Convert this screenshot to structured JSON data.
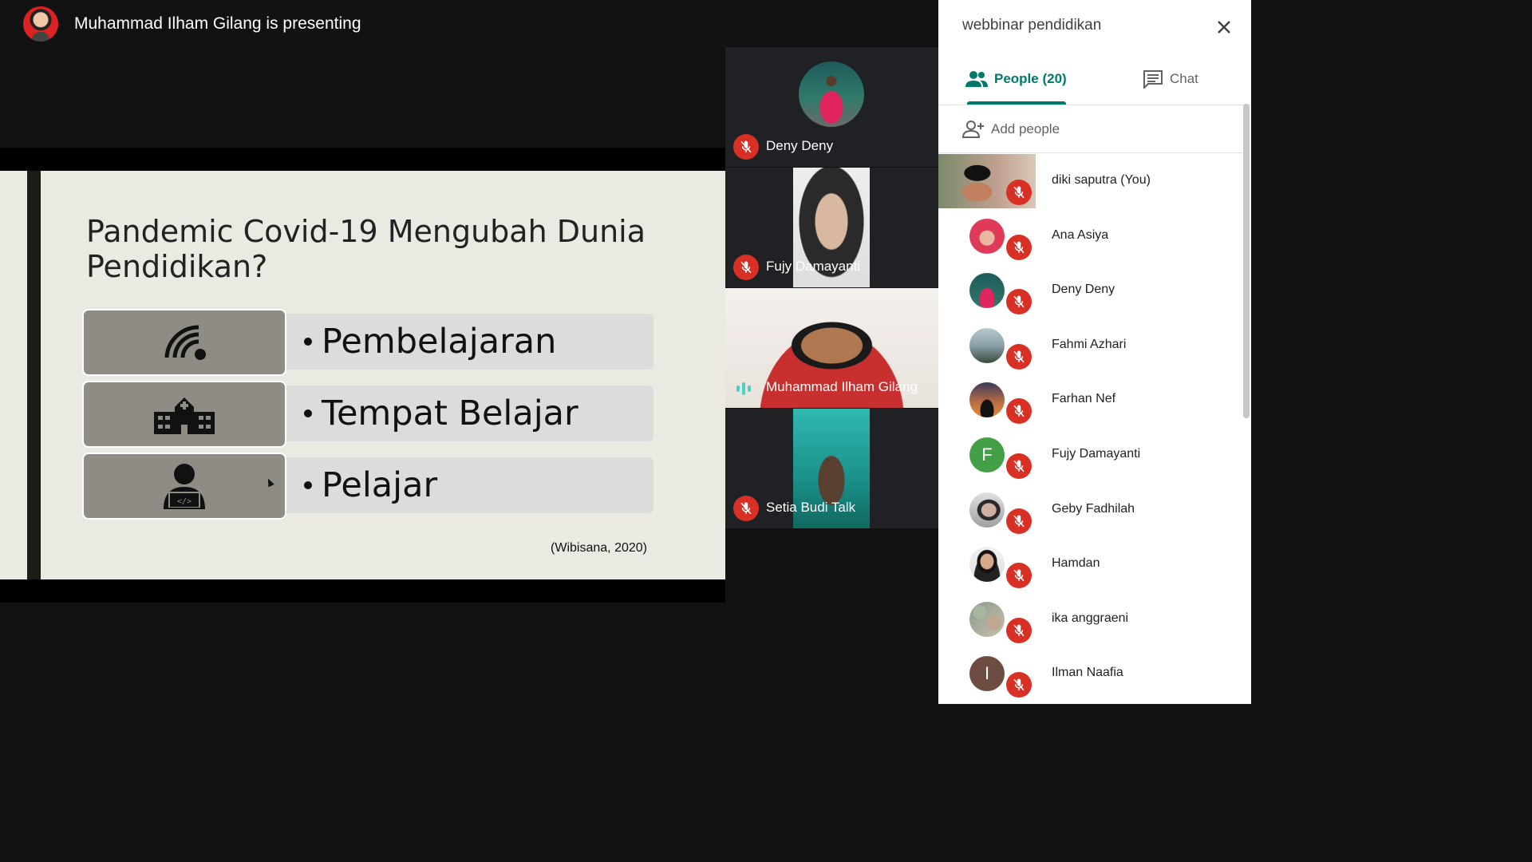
{
  "topbar": {
    "presenting_text": "Muhammad Ilham Gilang is presenting"
  },
  "slide": {
    "title": "Pandemic Covid-19 Mengubah Dunia Pendidikan?",
    "items": [
      {
        "label": "Pembelajaran",
        "icon": "wifi-icon"
      },
      {
        "label": "Tempat Belajar",
        "icon": "school-building-icon"
      },
      {
        "label": "Pelajar",
        "icon": "student-coder-icon"
      }
    ],
    "citation": "(Wibisana, 2020)"
  },
  "tiles": [
    {
      "name": "Deny Deny",
      "muted": true
    },
    {
      "name": "Fujy Damayanti",
      "muted": true
    },
    {
      "name": "Muhammad Ilham Gilang",
      "muted": false,
      "speaking": true
    },
    {
      "name": "Setia Budi Talk",
      "muted": true
    }
  ],
  "sidebar": {
    "meeting_title": "webbinar pendidikan",
    "tab_people": "People (20)",
    "tab_chat": "Chat",
    "add_people": "Add people",
    "people": [
      {
        "name": "diki saputra (You)",
        "avatar": "video-thumbnail"
      },
      {
        "name": "Ana Asiya",
        "avatar": "photo"
      },
      {
        "name": "Deny Deny",
        "avatar": "photo"
      },
      {
        "name": "Fahmi Azhari",
        "avatar": "photo"
      },
      {
        "name": "Farhan Nef",
        "avatar": "photo"
      },
      {
        "name": "Fujy Damayanti",
        "avatar": "F",
        "color": "#43a047"
      },
      {
        "name": "Geby Fadhilah",
        "avatar": "photo"
      },
      {
        "name": "Hamdan",
        "avatar": "photo"
      },
      {
        "name": "ika anggraeni",
        "avatar": "photo"
      },
      {
        "name": "Ilman Naafia",
        "avatar": "I",
        "color": "#6d4c41"
      }
    ]
  },
  "colors": {
    "accent": "#00796b",
    "mic_off": "#d93025",
    "speaking": "#4dd0c4"
  }
}
